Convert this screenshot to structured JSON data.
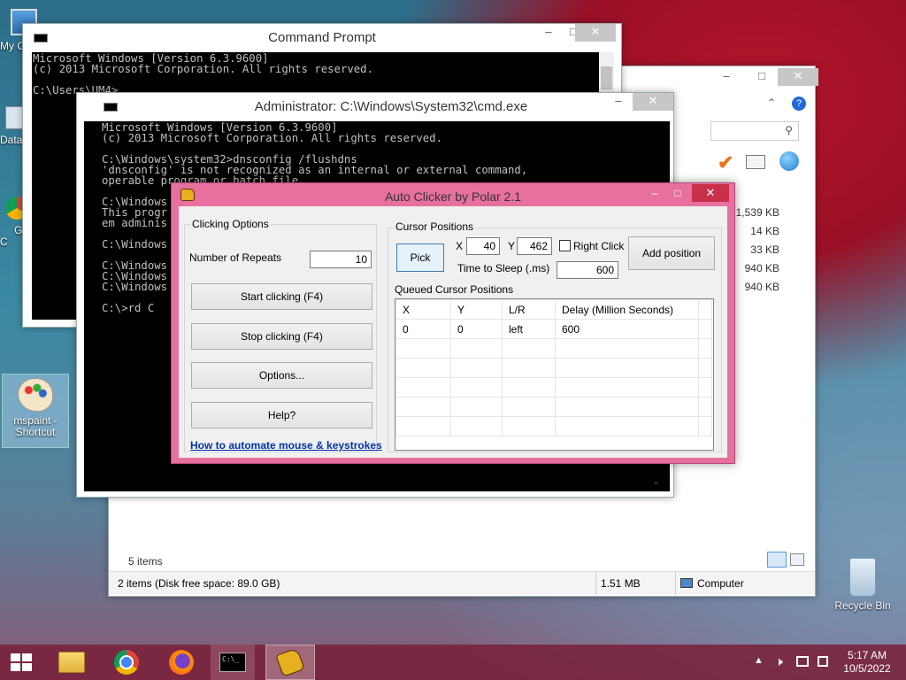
{
  "desktop": {
    "icons": [
      {
        "label": "My C"
      },
      {
        "label": "Data"
      },
      {
        "label": "G\nC"
      },
      {
        "label": "mspaint -\nShortcut"
      },
      {
        "label": "Recycle Bin"
      }
    ]
  },
  "cmd1": {
    "title": "Command Prompt",
    "text": "Microsoft Windows [Version 6.3.9600]\n(c) 2013 Microsoft Corporation. All rights reserved.\n\nC:\\Users\\UM4>"
  },
  "cmd2": {
    "title": "Administrator: C:\\Windows\\System32\\cmd.exe",
    "text": "Microsoft Windows [Version 6.3.9600]\n(c) 2013 Microsoft Corporation. All rights reserved.\n\nC:\\Windows\\system32>dnsconfig /flushdns\n'dnsconfig' is not recognized as an internal or external command,\noperable program or batch file.\n\nC:\\Windows\nThis progr\nem adminis\n\nC:\\Windows\n\nC:\\Windows\nC:\\Windows\nC:\\Windows\n\nC:\\>rd C"
  },
  "explorer": {
    "sizes": [
      "1,539 KB",
      "14 KB",
      "33 KB",
      "940 KB",
      "940 KB"
    ],
    "items_count": "5 items",
    "status_left": "2 items (Disk free space: 89.0 GB)",
    "status_size": "1.51 MB",
    "status_location": "Computer"
  },
  "autoclicker": {
    "title": "Auto Clicker by Polar 2.1",
    "clicking_options_label": "Clicking Options",
    "repeats_label": "Number of Repeats",
    "repeats_value": "10",
    "start_label": "Start clicking (F4)",
    "stop_label": "Stop clicking (F4)",
    "options_label": "Options...",
    "help_label": "Help?",
    "link_label": "How to automate mouse & keystrokes",
    "cursor_positions_label": "Cursor Positions",
    "pick_label": "Pick",
    "x_label": "X",
    "x_value": "40",
    "y_label": "Y",
    "y_value": "462",
    "right_click_label": "Right Click",
    "sleep_label": "Time to Sleep (.ms)",
    "sleep_value": "600",
    "add_position_label": "Add position",
    "queued_label": "Queued Cursor Positions",
    "columns": [
      "X",
      "Y",
      "L/R",
      "Delay (Million Seconds)"
    ],
    "rows": [
      [
        "0",
        "0",
        "left",
        "600"
      ]
    ]
  },
  "taskbar": {
    "time": "5:17 AM",
    "date": "10/5/2022"
  },
  "colors": {
    "ac_frame": "#e7709f",
    "ac_close": "#c9304c",
    "taskbar": "#7a1e37"
  }
}
